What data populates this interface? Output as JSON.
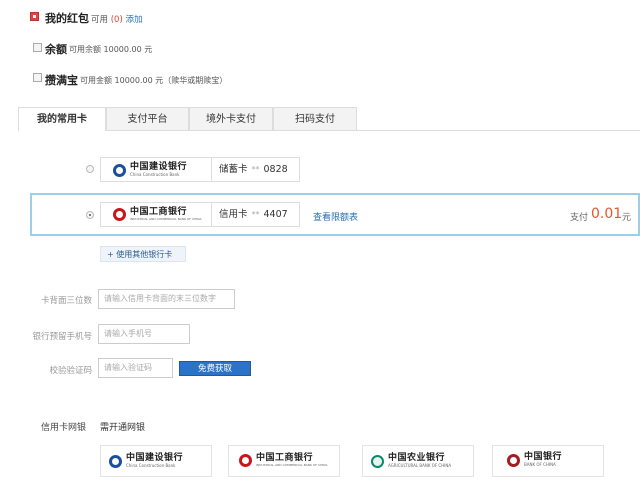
{
  "options": {
    "red_packet": {
      "label": "我的红包",
      "avail": "可用",
      "count": "(0)",
      "add": "添加"
    },
    "balance": {
      "label": "余额",
      "sub": "可用余额 10000.00 元"
    },
    "yuebao": {
      "label": "攒满宝",
      "sub": "可用金额 10000.00 元（赎华或期赎宝）"
    }
  },
  "tabs": [
    {
      "label": "我的常用卡"
    },
    {
      "label": "支付平台"
    },
    {
      "label": "境外卡支付"
    },
    {
      "label": "扫码支付"
    }
  ],
  "cards": [
    {
      "bank_cn": "中国建设银行",
      "bank_en": "China Construction Bank",
      "type": "储蓄卡",
      "stars": "**",
      "tail": "0828"
    },
    {
      "bank_cn": "中国工商银行",
      "bank_en": "INDUSTRIAL AND COMMERCIAL BANK OF CHINA",
      "type": "信用卡",
      "stars": "**",
      "tail": "4407",
      "limit_link": "查看限额表",
      "pay_label": "支付",
      "amount": "0.01",
      "unit": "元"
    }
  ],
  "add_other_card": "+ 使用其他银行卡",
  "form": {
    "cvv": {
      "label": "卡背面三位数",
      "placeholder": "请输入信用卡背面的末三位数字"
    },
    "phone": {
      "label": "银行预留手机号",
      "placeholder": "请输入手机号"
    },
    "code": {
      "label": "校验验证码",
      "placeholder": "请输入验证码",
      "button": "免费获取"
    }
  },
  "netbank": {
    "label": "信用卡网银",
    "link": "需开通网银",
    "banks": [
      {
        "cn": "中国建设银行",
        "en": "China Construction Bank"
      },
      {
        "cn": "中国工商银行",
        "en": "INDUSTRIAL AND COMMERCIAL BANK OF CHINA"
      },
      {
        "cn": "中国农业银行",
        "en": "AGRICULTURAL BANK OF CHINA"
      },
      {
        "cn": "中国银行",
        "en": "BANK OF CHINA"
      }
    ]
  },
  "colors": {
    "ccb": "#1b4f9e",
    "icbc": "#c8161d",
    "abc": "#0a8a6c",
    "boc": "#a41d23",
    "accent": "#d8463c",
    "link": "#2a6fb3"
  }
}
